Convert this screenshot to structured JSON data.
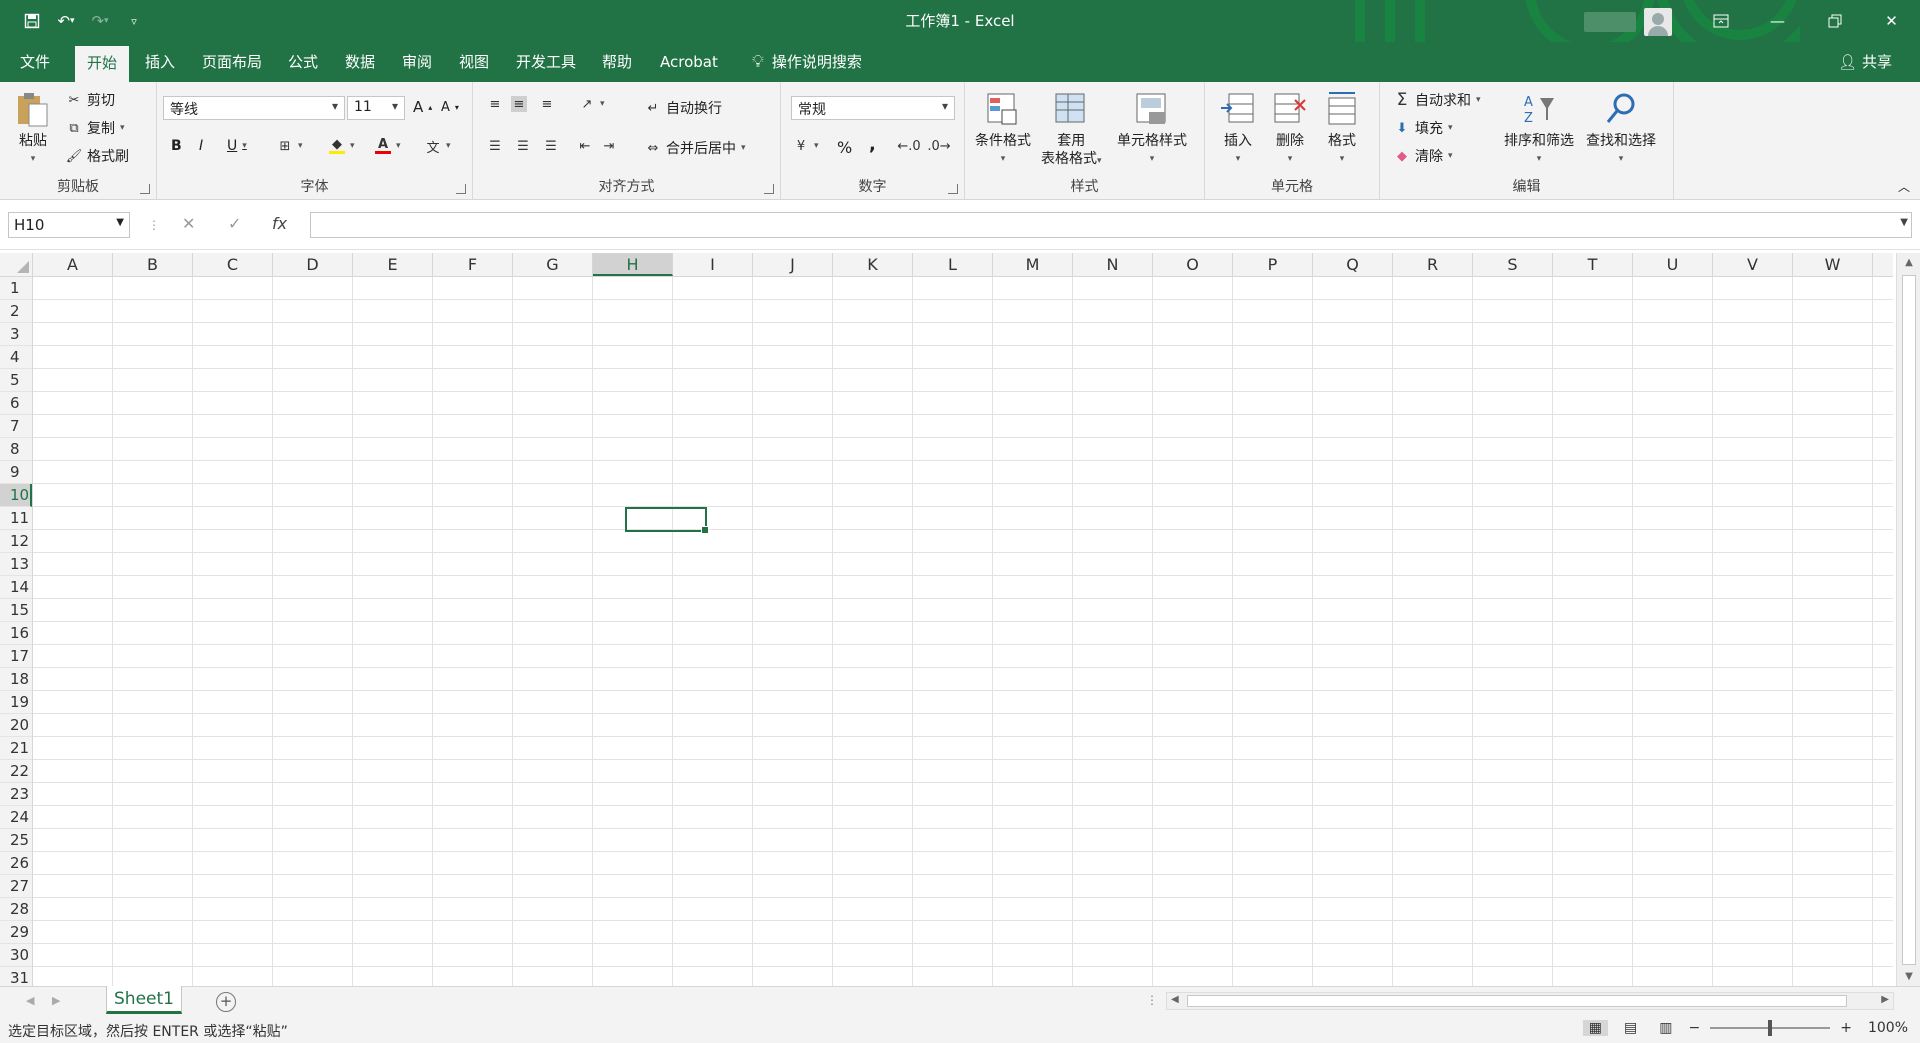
{
  "window": {
    "title": "工作簿1  -  Excel"
  },
  "ribbon_tabs": [
    "文件",
    "开始",
    "插入",
    "页面布局",
    "公式",
    "数据",
    "审阅",
    "视图",
    "开发工具",
    "帮助",
    "Acrobat"
  ],
  "tell_me": "操作说明搜索",
  "share": "共享",
  "clipboard": {
    "paste": "粘贴",
    "cut": "剪切",
    "copy": "复制",
    "format_painter": "格式刷",
    "label": "剪贴板"
  },
  "font": {
    "name": "等线",
    "size": "11",
    "label": "字体",
    "bold": "B",
    "italic": "I",
    "underline": "U"
  },
  "alignment": {
    "wrap": "自动换行",
    "merge": "合并后居中",
    "label": "对齐方式"
  },
  "number": {
    "format": "常规",
    "label": "数字",
    "percent": "%",
    "comma": ","
  },
  "styles": {
    "conditional": "条件格式",
    "table1": "套用",
    "table2": "表格格式",
    "cell_styles": "单元格样式",
    "label": "样式"
  },
  "cells_group": {
    "insert": "插入",
    "delete": "删除",
    "format": "格式",
    "label": "单元格"
  },
  "editing": {
    "autosum": "自动求和",
    "fill": "填充",
    "clear": "清除",
    "sort": "排序和筛选",
    "find": "查找和选择",
    "label": "编辑"
  },
  "formula_bar": {
    "name_box": "H10",
    "fx": "fx"
  },
  "columns": [
    "A",
    "B",
    "C",
    "D",
    "E",
    "F",
    "G",
    "H",
    "I",
    "J",
    "K",
    "L",
    "M",
    "N",
    "O",
    "P",
    "Q",
    "R",
    "S",
    "T",
    "U",
    "V",
    "W"
  ],
  "rows": [
    "1",
    "2",
    "3",
    "4",
    "5",
    "6",
    "7",
    "8",
    "9",
    "10",
    "11",
    "12",
    "13",
    "14",
    "15",
    "16",
    "17",
    "18",
    "19",
    "20",
    "21",
    "22",
    "23",
    "24",
    "25",
    "26",
    "27",
    "28",
    "29",
    "30",
    "31"
  ],
  "selected": {
    "column": "H",
    "row": "10"
  },
  "sheet": {
    "name": "Sheet1"
  },
  "status": {
    "text": "选定目标区域，然后按 ENTER 或选择“粘贴”",
    "zoom": "100%"
  },
  "colors": {
    "accent": "#217346",
    "ribbon_bg": "#f3f3f3"
  }
}
